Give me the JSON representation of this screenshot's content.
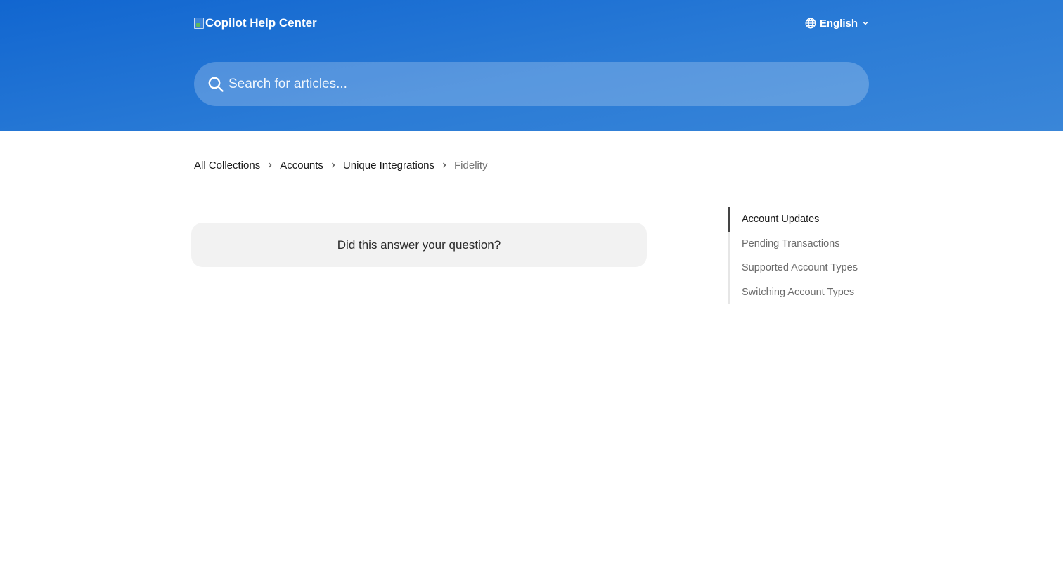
{
  "header": {
    "logo_text": "Copilot Help Center",
    "language": "English"
  },
  "search": {
    "placeholder": "Search for articles..."
  },
  "breadcrumb": {
    "items": [
      "All Collections",
      "Accounts",
      "Unique Integrations"
    ],
    "current": "Fidelity"
  },
  "feedback": {
    "question": "Did this answer your question?"
  },
  "toc": {
    "items": [
      "Account Updates",
      "Pending Transactions",
      "Supported Account Types",
      "Switching Account Types"
    ],
    "active_index": 0
  },
  "colors": {
    "hero_start": "#1166d0",
    "hero_end": "#3a86d8",
    "feedback_bg": "#f2f2f2",
    "toc_active": "#444444"
  }
}
